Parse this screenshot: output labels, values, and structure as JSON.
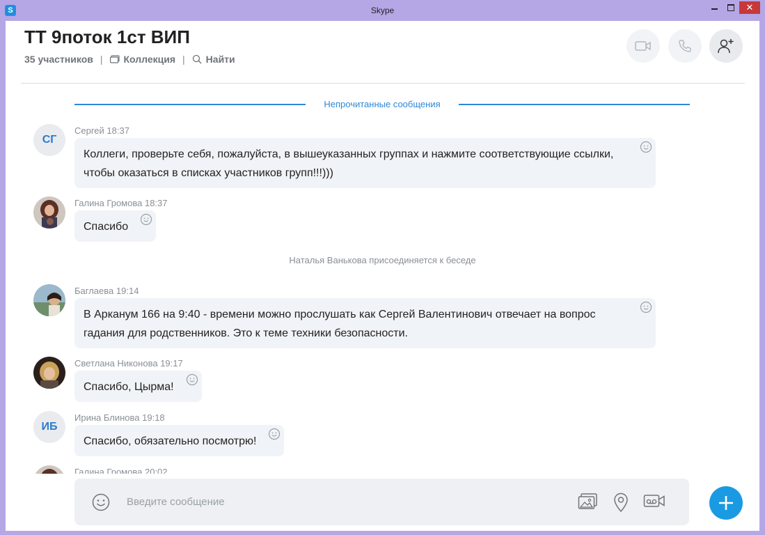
{
  "window": {
    "title": "Skype",
    "app_icon_letter": "S",
    "close_glyph": "✕"
  },
  "header": {
    "chat_title": "ТТ 9поток 1ст ВИП",
    "participants": "35 участников",
    "separator": "|",
    "collection_label": "Коллекция",
    "find_label": "Найти",
    "icons": [
      "video-call-icon",
      "audio-call-icon",
      "add-person-icon"
    ]
  },
  "unread_divider": "Непрочитанные сообщения",
  "messages": [
    {
      "sender": "Сергей",
      "time": "18:37",
      "initials": "СГ",
      "line1": "Коллеги, проверьте себя, пожалуйста, в вышеуказанных группах и нажмите соответствующие ссылки,",
      "line2": "чтобы оказаться в списках участников групп!!!)))"
    },
    {
      "sender": "Галина Громова",
      "time": "18:37",
      "line1": "Спасибо"
    },
    {
      "sender": "Баглаева",
      "time": "19:14",
      "line1": "В Арканум 166 на 9:40 - времени можно прослушать как Сергей Валентинович отвечает на вопрос",
      "line2": "гадания для родственников. Это к теме техники безопасности."
    },
    {
      "sender": "Светлана Никонова",
      "time": "19:17",
      "line1": "Спасибо, Цырма!"
    },
    {
      "sender": "Ирина Блинова",
      "time": "19:18",
      "initials": "ИБ",
      "line1": "Спасибо, обязательно посмотрю!"
    },
    {
      "sender": "Галина Громова",
      "time": "20:02"
    }
  ],
  "system_message": "Наталья Ванькова присоединяется к беседе",
  "composer": {
    "placeholder": "Введите сообщение",
    "icons": [
      "emoji-icon",
      "media-gallery-icon",
      "location-icon",
      "video-message-icon",
      "add-icon"
    ]
  },
  "colors": {
    "accent": "#2f88d6",
    "fab": "#1b9ae4",
    "bubble": "#f0f3f7",
    "window_frame": "#b5a7e6",
    "close_button": "#c7383a"
  }
}
